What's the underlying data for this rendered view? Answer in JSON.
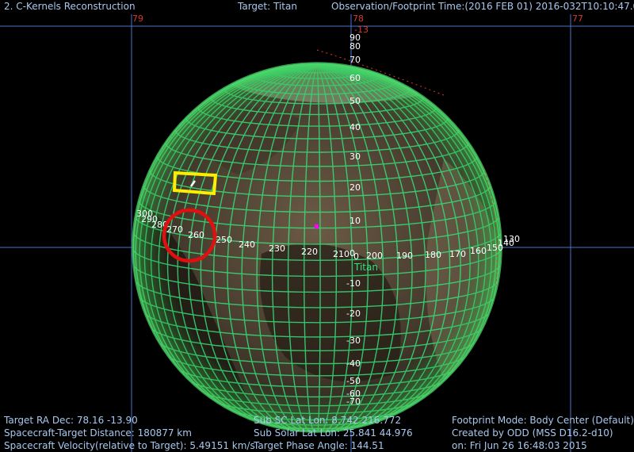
{
  "header": {
    "app_title": "2. C-Kernels Reconstruction",
    "target": "Target: Titan",
    "observation_time": "Observation/Footprint Time:(2016 FEB 01) 2016-032T10:10:47.00"
  },
  "frame_ticks": {
    "left": "79",
    "center": "78",
    "center_below": "-13",
    "right": "77"
  },
  "globe": {
    "body_label": "Titan",
    "lat_labels": [
      "90",
      "80",
      "70",
      "60",
      "50",
      "40",
      "30",
      "20",
      "10",
      "0",
      "-10",
      "-20",
      "-30",
      "-40",
      "-50",
      "-60",
      "-70"
    ],
    "lon_labels_left": [
      "300",
      "290",
      "280",
      "270",
      "260",
      "250",
      "240",
      "230",
      "220",
      "210"
    ],
    "lon_labels_right": [
      "200",
      "190",
      "180",
      "170",
      "160",
      "150",
      "140",
      "130"
    ]
  },
  "footer": {
    "left": [
      "Target RA Dec: 78.16  -13.90",
      "Spacecraft-Target Distance: 180877 km",
      "Spacecraft Velocity(relative to Target): 5.49151 km/s"
    ],
    "center": [
      "Sub SC Lat Lon: 8.742  216.772",
      "Sub Solar Lat Lon: 25.841  44.976",
      "Target Phase Angle: 144.51"
    ],
    "right": [
      "Footprint Mode: Body Center (Default)",
      "Created by ODD (MSS D16.2-d10)",
      "on: Fri Jun 26 16:48:03 2015"
    ]
  },
  "colors": {
    "hud_text": "#a9c8ee",
    "frame_tick": "#d83a2a",
    "frame_lines": "#4a74c8",
    "grid": "#35e07a",
    "fov_box": "#ffee00",
    "fov_circle": "#e01010",
    "subsc_marker": "#ff00ff"
  }
}
